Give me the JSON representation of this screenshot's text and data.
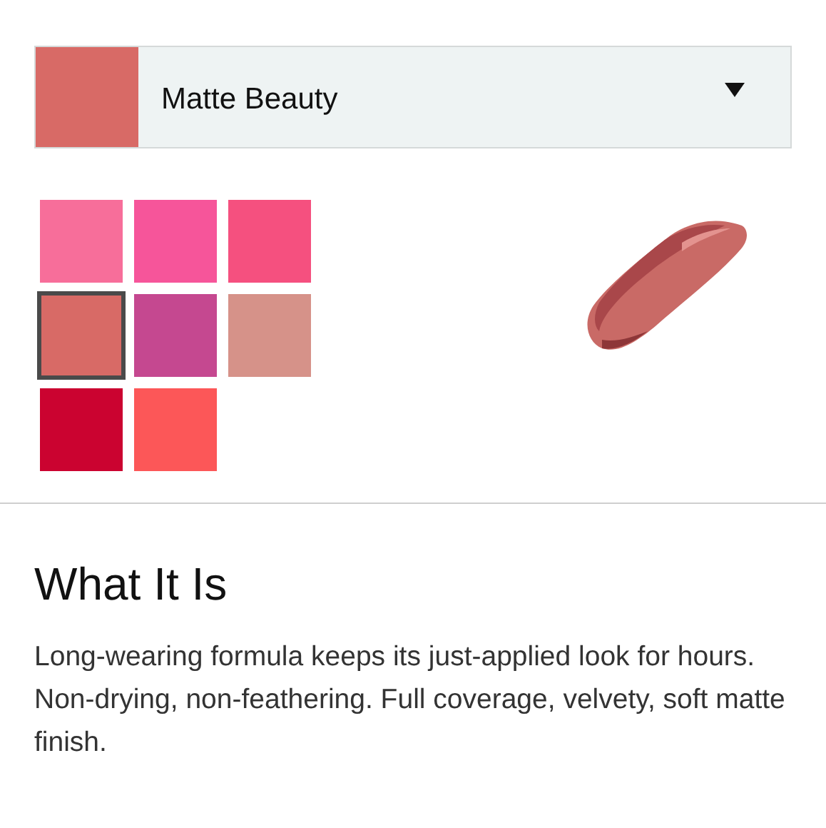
{
  "shade_select": {
    "value": "Matte Beauty",
    "color": "#d86a66"
  },
  "swatches": [
    {
      "color": "#f76e9a",
      "selected": false
    },
    {
      "color": "#f6559a",
      "selected": false
    },
    {
      "color": "#f5507f",
      "selected": false
    },
    {
      "color": "#d86a66",
      "selected": true
    },
    {
      "color": "#c54890",
      "selected": false
    },
    {
      "color": "#d69289",
      "selected": false
    },
    {
      "color": "#cb0330",
      "selected": false
    },
    {
      "color": "#fc5758",
      "selected": false
    }
  ],
  "section": {
    "heading": "What It Is",
    "body": "Long-wearing formula keeps its just-applied look for hours. Non-drying, non-feathering. Full coverage, velvety, soft matte finish."
  }
}
